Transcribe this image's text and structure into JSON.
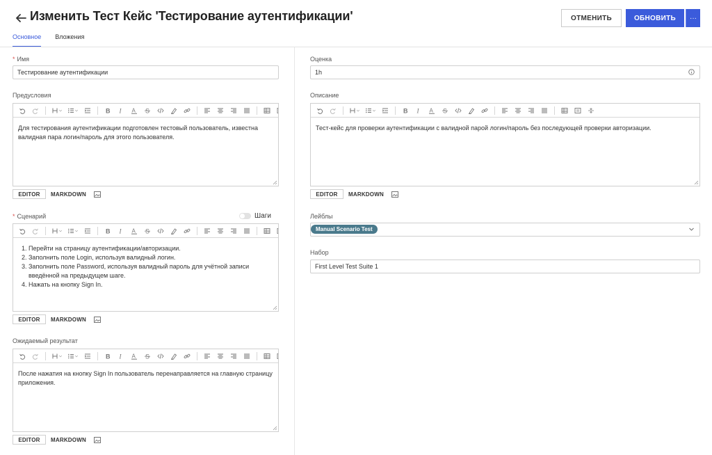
{
  "header": {
    "title": "Изменить Тест Кейс 'Тестирование аутентификации'",
    "cancel_label": "ОТМЕНИТЬ",
    "update_label": "ОБНОВИТЬ",
    "more_label": "···"
  },
  "tabs": [
    {
      "label": "Основное",
      "active": true
    },
    {
      "label": "Вложения",
      "active": false
    }
  ],
  "left": {
    "name": {
      "label": "Имя",
      "required": true,
      "value": "Тестирование аутентификации"
    },
    "preconditions": {
      "label": "Предусловия",
      "text": "Для тестирования аутентификации подготовлен тестовый пользователь, известна валидная пара логин/пароль для этого пользователя."
    },
    "scenario": {
      "label": "Сценарий",
      "required": true,
      "toggle_label": "Шаги",
      "steps": [
        "Перейти на страницу аутентификации/авторизации.",
        "Заполнить поле Login, используя валидный логин.",
        "Заполнить поле Password, используя валидный пароль для учётной записи введённой на предыдущем шаге.",
        "Нажать на кнопку Sign In."
      ]
    },
    "expected": {
      "label": "Ожидаемый результат",
      "text": "После нажатия на кнопку Sign In пользователь перенаправляется на главную страницу приложения."
    }
  },
  "right": {
    "estimate": {
      "label": "Оценка",
      "value": "1h"
    },
    "description": {
      "label": "Описание",
      "text": "Тест-кейс для проверки аутентификации с валидной парой логин/пароль без последующей проверки авторизации."
    },
    "labels": {
      "label": "Лейблы",
      "chips": [
        "Manual Scenario Test"
      ]
    },
    "suite": {
      "label": "Набор",
      "value": "First Level Test Suite 1"
    }
  },
  "editor_modes": {
    "editor": "EDITOR",
    "markdown": "MARKDOWN"
  },
  "toolbar_icons": [
    "undo-icon",
    "redo-icon",
    "heading-icon",
    "bullet-list-icon",
    "indent-icon",
    "bold-icon",
    "italic-icon",
    "text-color-icon",
    "strikethrough-icon",
    "code-icon",
    "highlight-icon",
    "link-icon",
    "align-left-icon",
    "align-center-icon",
    "align-right-icon",
    "align-justify-icon",
    "table-icon",
    "block-icon",
    "divider-icon"
  ],
  "colors": {
    "accent": "#3b5bdb",
    "chip": "#4a7a8c",
    "required": "#d9534f"
  }
}
